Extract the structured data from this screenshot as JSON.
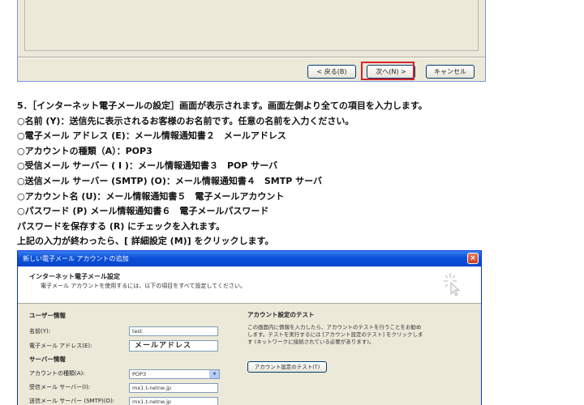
{
  "top_dialog": {
    "buttons": {
      "back": "< 戻る(B)",
      "next": "次へ(N) >",
      "cancel": "キャンセル"
    }
  },
  "instructions": [
    "5．［インターネット電子メールの設定］画面が表示されます。画面左側より全ての項目を入力します。",
    "○名前 (Y)：送信先に表示されるお客様のお名前です。任意の名前を入力ください。",
    "○電子メール アドレス (E)：メール情報通知書２　メールアドレス",
    "○アカウントの種類（A）：POP3",
    "○受信メール サーバー ( I )：メール情報通知書３　POP サーバ",
    "○送信メール サーバー (SMTP) (O)：メール情報通知書４　SMTP サーバ",
    "○アカウント名 (U)：メール情報通知書５　電子メールアカウント",
    "○パスワード (P) メール情報通知書６　電子メールパスワード",
    "パスワードを保存する (R) にチェックを入れます。",
    "上記の入力が終わったら、[ 詳細設定 (M)] をクリックします。"
  ],
  "dialog": {
    "title": "新しい電子メール アカウントの追加",
    "header_title": "インターネット電子メール設定",
    "header_subtitle": "電子メール アカウントを使用するには、以下の項目をすべて設定してください。",
    "user_info_heading": "ユーザー情報",
    "name_label": "名前(Y):",
    "name_value": "test",
    "email_label": "電子メール アドレス(E):",
    "email_value": "メールアドレス",
    "server_info_heading": "サーバー情報",
    "account_type_label": "アカウントの種類(A):",
    "account_type_value": "POP3",
    "incoming_label": "受信メール サーバー(I):",
    "incoming_value": "mx1.t-netne.jp",
    "outgoing_label": "送信メール サーバー (SMTP)(O):",
    "outgoing_value": "mx1.t-netne.jp",
    "test_heading": "アカウント設定のテスト",
    "test_description": "この画面内に情報を入力したら、アカウントのテストを行うことをお勧めします。テストを実行するには [アカウント設定のテスト] をクリックします (ネットワークに接続されている必要があります)。",
    "test_button": "アカウント設定のテスト(T)",
    "close_glyph": "×"
  }
}
